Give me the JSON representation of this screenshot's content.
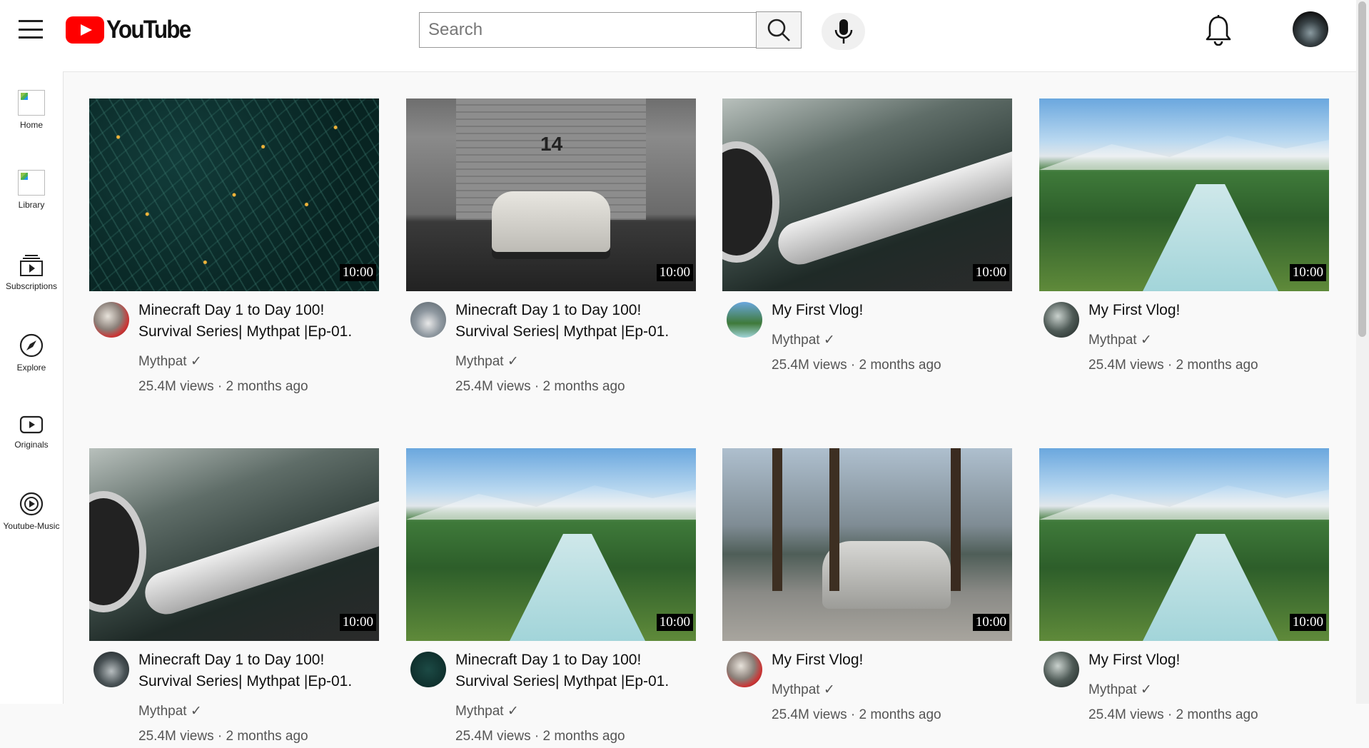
{
  "header": {
    "logo_text": "YouTube",
    "search_placeholder": "Search"
  },
  "sidebar": {
    "items": [
      {
        "label": "Home"
      },
      {
        "label": "Library"
      },
      {
        "label": "Subscriptions"
      },
      {
        "label": "Explore"
      },
      {
        "label": "Originals"
      },
      {
        "label": "Youtube-Music"
      }
    ]
  },
  "videos": [
    {
      "title": "Minecraft Day 1 to Day 100! Survival Series| Mythpat |Ep-01.",
      "channel": "Mythpat ✓",
      "stats": "25.4M views · 2 months ago",
      "duration": "10:00"
    },
    {
      "title": "Minecraft Day 1 to Day 100! Survival Series| Mythpat |Ep-01.",
      "channel": "Mythpat ✓",
      "stats": "25.4M views · 2 months ago",
      "duration": "10:00",
      "overlay": "14"
    },
    {
      "title": "My First Vlog!",
      "channel": "Mythpat ✓",
      "stats": "25.4M views · 2 months ago",
      "duration": "10:00"
    },
    {
      "title": "My First Vlog!",
      "channel": "Mythpat ✓",
      "stats": "25.4M views · 2 months ago",
      "duration": "10:00"
    },
    {
      "title": "Minecraft Day 1 to Day 100! Survival Series| Mythpat |Ep-01.",
      "channel": "Mythpat ✓",
      "stats": "25.4M views · 2 months ago",
      "duration": "10:00"
    },
    {
      "title": "Minecraft Day 1 to Day 100! Survival Series| Mythpat |Ep-01.",
      "channel": "Mythpat ✓",
      "stats": "25.4M views · 2 months ago",
      "duration": "10:00"
    },
    {
      "title": "My First Vlog!",
      "channel": "Mythpat ✓",
      "stats": "25.4M views · 2 months ago",
      "duration": "10:00"
    },
    {
      "title": "My First Vlog!",
      "channel": "Mythpat ✓",
      "stats": "25.4M views · 2 months ago",
      "duration": "10:00"
    }
  ],
  "colors": {
    "brand_red": "#ff0000"
  },
  "icons": [
    "menu-icon",
    "search-icon",
    "mic-icon",
    "bell-icon",
    "subscriptions-icon",
    "explore-icon",
    "originals-icon",
    "music-icon"
  ]
}
